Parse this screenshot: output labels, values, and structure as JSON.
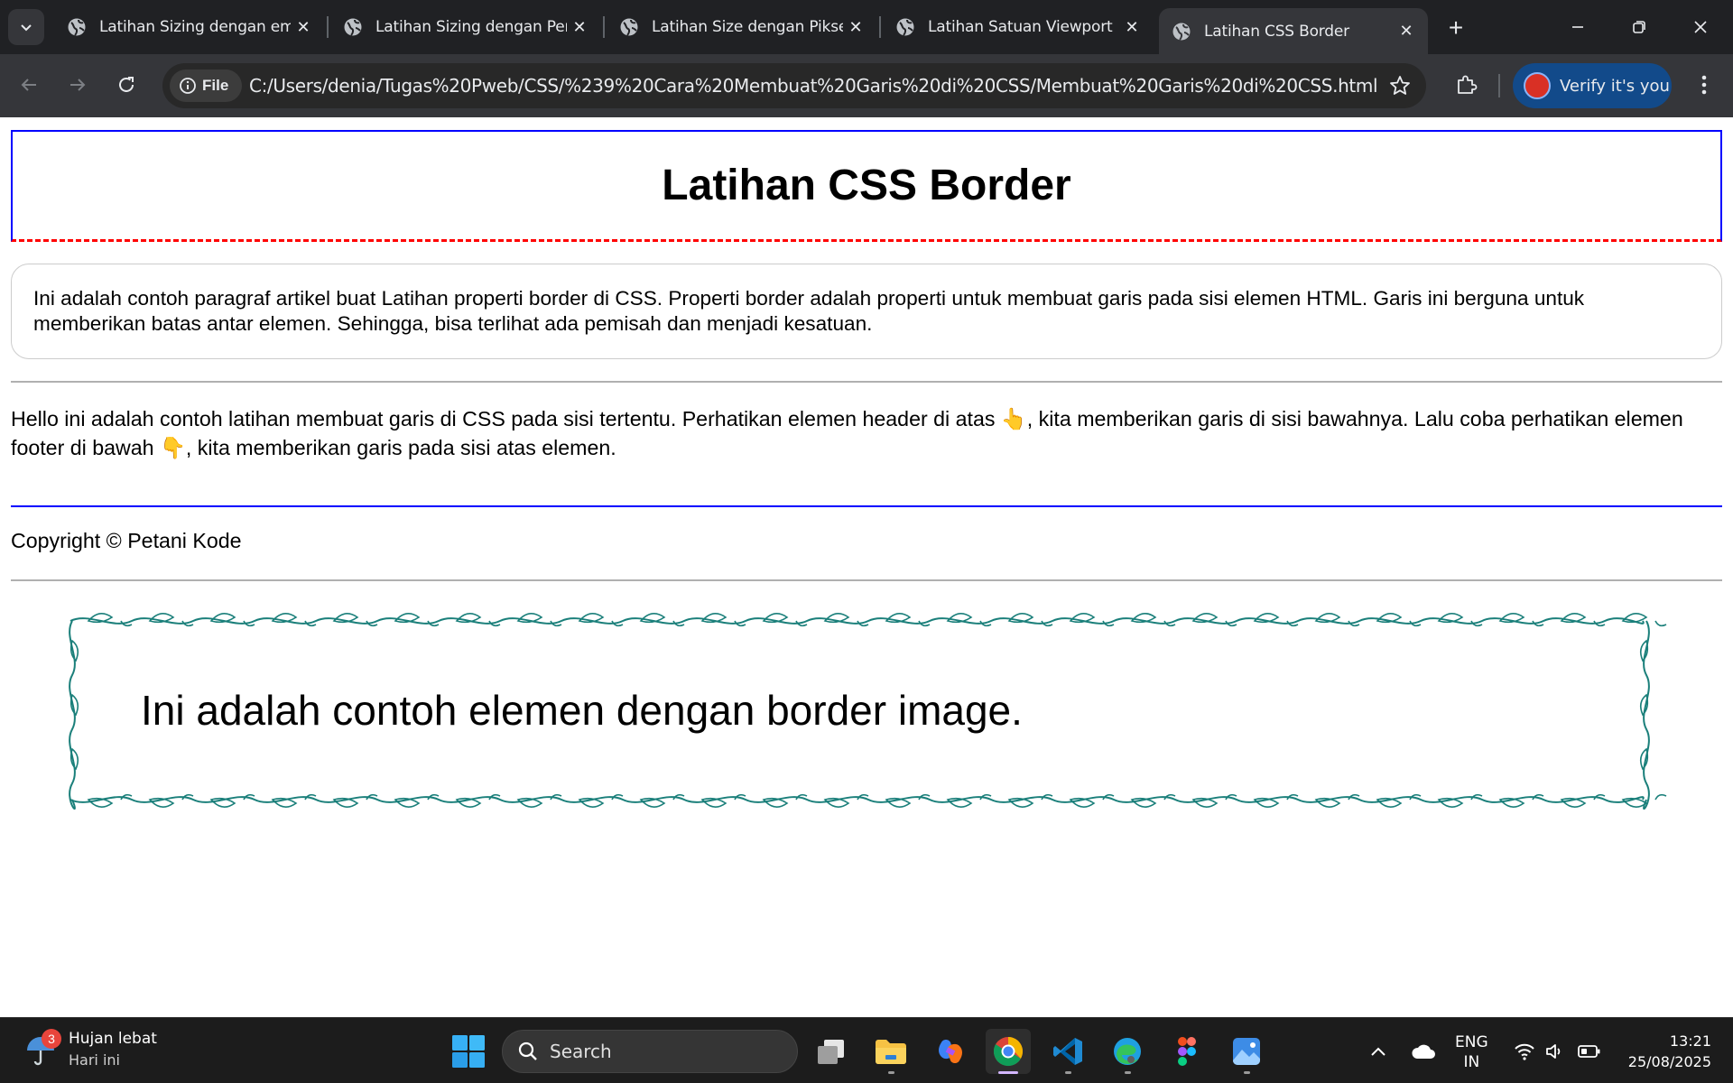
{
  "browser": {
    "tabs": [
      {
        "title": "Latihan Sizing dengan em",
        "active": false
      },
      {
        "title": "Latihan Sizing dengan Persen",
        "active": false
      },
      {
        "title": "Latihan Size dengan Piksel",
        "active": false
      },
      {
        "title": "Latihan Satuan Viewport",
        "active": false
      },
      {
        "title": "Latihan CSS Border",
        "active": true
      }
    ],
    "close_glyph": "✕",
    "new_tab_glyph": "+",
    "address": {
      "scheme_label": "File",
      "url": "C:/Users/denia/Tugas%20Pweb/CSS/%239%20Cara%20Membuat%20Garis%20di%20CSS/Membuat%20Garis%20di%20CSS.html"
    },
    "verify_label": "Verify it's you"
  },
  "page": {
    "header_title": "Latihan CSS Border",
    "article_text": "Ini adalah contoh paragraf artikel buat Latihan properti border di CSS. Properti border adalah properti untuk membuat garis pada sisi elemen HTML. Garis ini berguna untuk memberikan batas antar elemen. Sehingga, bisa terlihat ada pemisah dan menjadi kesatuan.",
    "section_text_1": "Hello ini adalah contoh latihan membuat garis di CSS pada sisi tertentu. Perhatikan elemen header di atas ",
    "emoji_up": "👆",
    "section_text_2": ", kita memberikan garis di sisi bawahnya. Lalu coba perhatikan elemen footer di bawah ",
    "emoji_down": "👇",
    "section_text_3": ", kita memberikan garis pada sisi atas elemen.",
    "footer_text": "Copyright © Petani Kode",
    "border_image_text": "Ini adalah contoh elemen dengan border image."
  },
  "colors": {
    "header_border": "#0000ff",
    "header_bottom_border": "#ff0000",
    "footer_top_border": "#0000ff",
    "ornament": "#1a7f7a"
  },
  "taskbar": {
    "weather_title": "Hujan lebat",
    "weather_sub": "Hari ini",
    "weather_badge": "3",
    "search_placeholder": "Search",
    "lang_top": "ENG",
    "lang_bottom": "IN",
    "time": "13:21",
    "date": "25/08/2025",
    "apps": [
      "task-view",
      "file-explorer",
      "copilot",
      "chrome",
      "vscode",
      "edge",
      "figma",
      "photos"
    ]
  }
}
